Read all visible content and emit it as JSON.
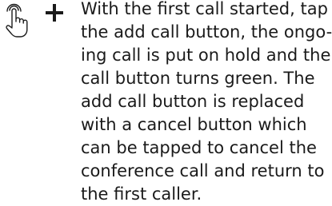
{
  "step": {
    "tap_icon": "tap-gesture-icon",
    "action_icon": "plus-icon",
    "lines": [
      "With the first call started, tap",
      "the add call button, the ongo-",
      "ing call is put on hold and the",
      "call button turns green. The",
      "add call button is replaced",
      "with a cancel button which",
      "can be tapped to cancel the",
      "conference call and return to",
      "the first caller."
    ]
  },
  "colors": {
    "text": "#1a1a1a",
    "icon": "#1a1a1a"
  }
}
